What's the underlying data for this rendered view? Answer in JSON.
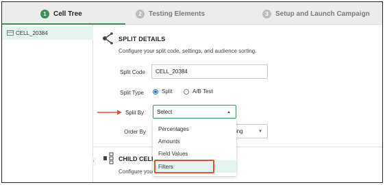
{
  "stepper": {
    "steps": [
      {
        "num": "1",
        "label": "Cell Tree"
      },
      {
        "num": "2",
        "label": "Testing Elements"
      },
      {
        "num": "3",
        "label": "Setup and Launch Campaign"
      }
    ]
  },
  "sidebar": {
    "tree_item": "CELL_20384"
  },
  "split_details": {
    "title": "SPLIT DETAILS",
    "subtitle": "Configure your split code, settings, and audience sorting.",
    "split_code_label": "Split Code",
    "split_code_value": "CELL_20384",
    "split_type_label": "Split Type",
    "split_type_options": [
      "Split",
      "A/B Test"
    ],
    "split_type_selected": "Split",
    "split_by_label": "Split By",
    "split_by_value": "Select",
    "order_by_label": "Order By",
    "order_by_value_partial": "ing"
  },
  "split_by_dropdown": {
    "options": [
      "Percentages",
      "Amounts",
      "Field Values",
      "Filters"
    ],
    "highlighted": "Filters"
  },
  "child_cells": {
    "title": "CHILD CELLS",
    "subtitle_partial": "Configure your"
  },
  "colors": {
    "accent_green": "#3e8e5a",
    "highlight_red": "#e0522d",
    "radio_blue": "#2b6fd6"
  }
}
